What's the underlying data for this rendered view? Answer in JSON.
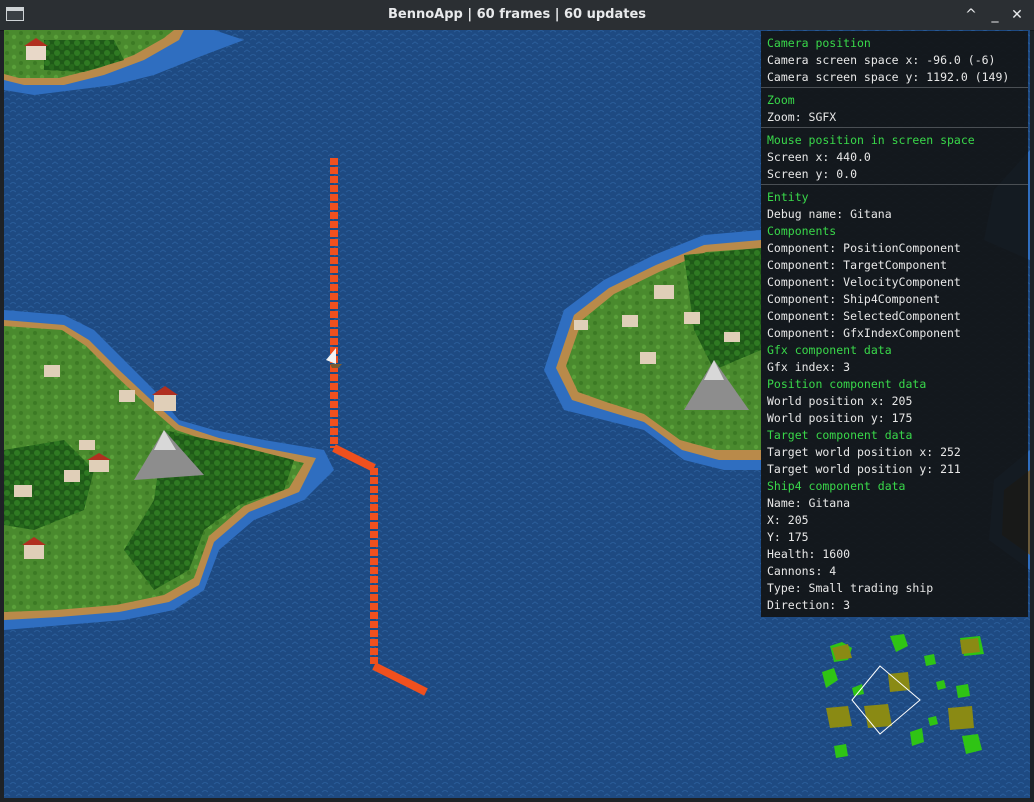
{
  "window": {
    "title": "BennoApp  |  60 frames  |  60 updates",
    "buttons": {
      "maximize": "^",
      "minimize": "_",
      "close": "✕"
    }
  },
  "debug": {
    "camera": {
      "heading": "Camera position",
      "x": "Camera screen space x: -96.0 (-6)",
      "y": "Camera screen space y: 1192.0 (149)"
    },
    "zoom": {
      "heading": "Zoom",
      "value": "Zoom: SGFX"
    },
    "mouse": {
      "heading": "Mouse position in screen space",
      "x": "Screen x: 440.0",
      "y": "Screen y: 0.0"
    },
    "entity": {
      "heading": "Entity",
      "debug_name": "Debug name: Gitana",
      "components_heading": "Components",
      "components": [
        "Component: PositionComponent",
        "Component: TargetComponent",
        "Component: VelocityComponent",
        "Component: Ship4Component",
        "Component: SelectedComponent",
        "Component: GfxIndexComponent"
      ],
      "gfx_heading": "Gfx component data",
      "gfx_index": "Gfx index: 3",
      "position_heading": "Position component data",
      "world_x": "World position x: 205",
      "world_y": "World position y: 175",
      "target_heading": "Target component data",
      "target_x": "Target world position x: 252",
      "target_y": "Target world position y: 211",
      "ship_heading": "Ship4 component data",
      "ship": [
        "Name: Gitana",
        "X: 205",
        "Y: 175",
        "Health: 1600",
        "Cannons: 4",
        "Type: Small trading ship",
        "Direction: 3"
      ]
    }
  },
  "colors": {
    "heading": "#39d84a",
    "path": "#f0501e",
    "sea": "#1e4a82",
    "land": "#3f8a2a",
    "minimap_land": "#2fc414",
    "minimap_island": "#8a8a14"
  },
  "icons": {
    "ship": "sailing-ship-icon",
    "window": "window-app-icon"
  }
}
